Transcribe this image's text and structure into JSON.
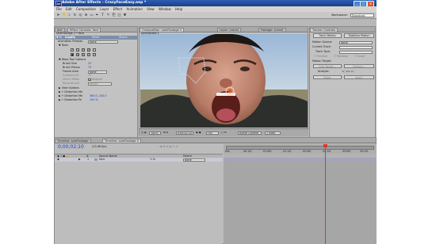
{
  "window": {
    "title": "Adobe After Effects - CrazyFaceEasy.aep *"
  },
  "menu": [
    "File",
    "Edit",
    "Composition",
    "Layer",
    "Effect",
    "Animation",
    "View",
    "Window",
    "Help"
  ],
  "workspace": {
    "label": "Workspace:",
    "value": "Standard"
  },
  "left_panel": {
    "tabs": [
      "ject",
      "Effect Controls: face"
    ],
    "layer_path": "samFootage 2 * face",
    "effect": {
      "name": "Liquify",
      "reset": "Reset",
      "about": "About..."
    },
    "animation_presets": {
      "label": "Animation Presets:",
      "value": "None"
    },
    "sections": {
      "tools": "Tools",
      "warp_tool_options": "Warp Tool Options",
      "view_options": "View Options",
      "distortion_mesh": "Distortion Me",
      "distortion_mesh_offset": "Distortion Me",
      "distortion_percentage": "Distortion Pe"
    },
    "fields": {
      "brush_size": {
        "label": "Brush Size",
        "value": "31"
      },
      "brush_pressure": {
        "label": "Brush Pressu",
        "value": "75"
      },
      "freeze_area": {
        "label": "Freeze Area",
        "value": "None"
      },
      "turbulent_jitter": {
        "label": "Turbulent Jit",
        "value": "70"
      },
      "clone_offset": {
        "label": "Clone Offset",
        "checkbox": "Aligned"
      },
      "reconstruction_mode": {
        "label": "Reconstructi",
        "value": "Revert"
      },
      "distortion_mesh_offset_value": "360.0, 240.0",
      "distortion_percentage_value": "100 %"
    }
  },
  "comp_panel": {
    "tabs": [
      "Composition: samFootage 2",
      "Layer: (none)",
      "Footage: (none)"
    ],
    "comp_tab_label": "samFootage 2",
    "zoom": "100%",
    "timecode": "0:00:02:10",
    "resolution": "Full",
    "camera": "Active Camera",
    "view_layout": "1 View"
  },
  "tracker_panel": {
    "tabs": [
      "Tracker Controls"
    ],
    "track_motion": "Track Motion",
    "stabilize_motion": "Stabilize Motion",
    "motion_source": {
      "label": "Motion Source:",
      "value": "None"
    },
    "current_track": {
      "label": "Current Track:",
      "value": ""
    },
    "track_type": {
      "label": "Track Type:",
      "value": ""
    },
    "position": "Position",
    "rotation": "Rotation",
    "scale": "Scale",
    "motion_target": "Motion Target:",
    "edit_target": "Edit Target...",
    "options": "Options...",
    "analyze": "Analyze:",
    "reset": "Reset",
    "apply": "Apply"
  },
  "timeline": {
    "tabs": [
      "Timeline: samFootage",
      "Timeline: samFootage 2"
    ],
    "timecode": "0;00;02;10",
    "fps": "(23.98 fps)",
    "columns": {
      "number": "#",
      "source_name": "Source Name",
      "parent": "Parent"
    },
    "layers": [
      {
        "number": "1",
        "name": "face",
        "parent": "None"
      }
    ],
    "ruler_labels": [
      "00s",
      "00:12f",
      "01:00f",
      "01:12f",
      "02:00f",
      "02:12f",
      "03:00f",
      "03:12f"
    ]
  }
}
